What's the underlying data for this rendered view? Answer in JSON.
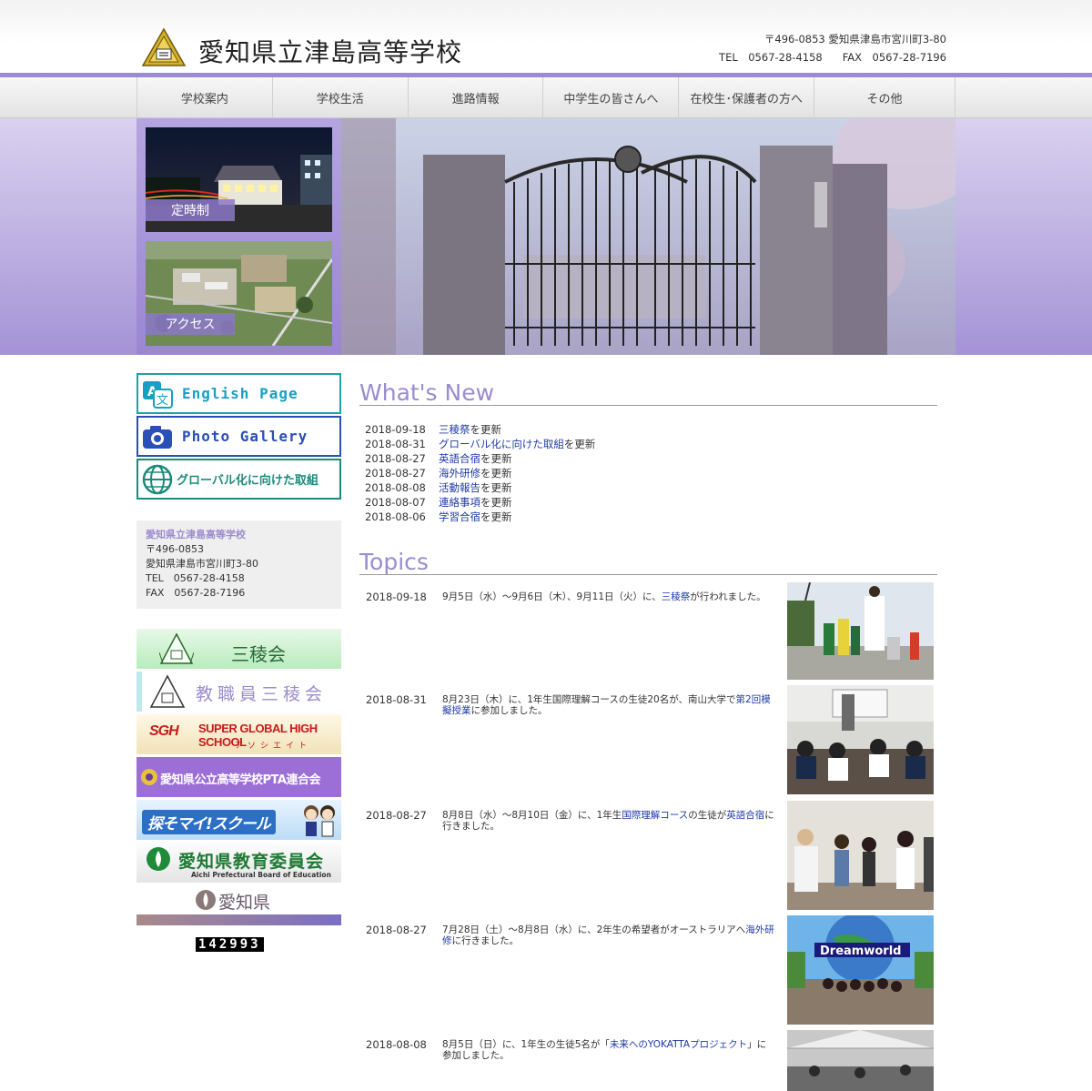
{
  "header": {
    "title": "愛知県立津島高等学校",
    "address": "〒496-0853 愛知県津島市宮川町3-80",
    "tel": "TEL　0567-28-4158",
    "fax": "FAX　0567-28-7196"
  },
  "nav": [
    "学校案内",
    "学校生活",
    "進路情報",
    "中学生の皆さんへ",
    "在校生･保護者の方へ",
    "その他"
  ],
  "hero": {
    "night_caption": "定時制",
    "access_caption": "アクセス"
  },
  "sidebar": {
    "links": [
      {
        "label": "English Page",
        "color": "#1a9fc4",
        "icon": "translate-icon"
      },
      {
        "label": "Photo Gallery",
        "color": "#2a4fb6",
        "icon": "camera-icon"
      },
      {
        "label": "グローバル化に向けた取組",
        "color": "#1c8a7a",
        "icon": "globe-icon"
      }
    ],
    "info": {
      "name": "愛知県立津島高等学校",
      "zip": "〒496-0853",
      "address": "愛知県津島市宮川町3-80",
      "tel": "TEL　0567-28-4158",
      "fax": "FAX　0567-28-7196"
    },
    "banners": {
      "sanryokai": "三稜会",
      "staff": "教職員三稜会",
      "sgh": "SUPER GLOBAL HIGH SCHOOL",
      "sgh_sub": "アソシエイト",
      "sgh_logo": "SGH",
      "pta": "愛知県公立高等学校PTA連合会",
      "myschool": "探そマイ!スクール",
      "board": "愛知県教育委員会",
      "board_en": "Aichi Prefectural Board of Education",
      "pref": "愛知県"
    },
    "counter": "142993"
  },
  "whats_new": {
    "title": "What's New",
    "items": [
      {
        "date": "2018-09-18",
        "link": "三稜祭",
        "suffix": "を更新"
      },
      {
        "date": "2018-08-31",
        "link": "グローバル化に向けた取組",
        "suffix": "を更新"
      },
      {
        "date": "2018-08-27",
        "link": "英語合宿",
        "suffix": "を更新"
      },
      {
        "date": "2018-08-27",
        "link": "海外研修",
        "suffix": "を更新"
      },
      {
        "date": "2018-08-08",
        "link": "活動報告",
        "suffix": "を更新"
      },
      {
        "date": "2018-08-07",
        "link": "連絡事項",
        "suffix": "を更新"
      },
      {
        "date": "2018-08-06",
        "link": "学習合宿",
        "suffix": "を更新"
      }
    ]
  },
  "topics": {
    "title": "Topics",
    "items": [
      {
        "date": "2018-09-18",
        "pre": "9月5日（水）～9月6日（木）、9月11日（火）に、",
        "link": "三稜祭",
        "post": "が行われました。"
      },
      {
        "date": "2018-08-31",
        "pre": "8月23日（木）に、1年生国際理解コースの生徒20名が、南山大学で",
        "link": "第2回模擬授業",
        "post": "に参加しました。"
      },
      {
        "date": "2018-08-27",
        "pre": "8月8日（水）～8月10日（金）に、1年生",
        "link": "国際理解コース",
        "mid": "の生徒が",
        "link2": "英語合宿",
        "post": "に行きました。"
      },
      {
        "date": "2018-08-27",
        "pre": "7月28日（土）～8月8日（水）に、2年生の希望者がオーストラリアへ",
        "link": "海外研修",
        "post": "に行きました。"
      },
      {
        "date": "2018-08-08",
        "pre": "8月5日（日）に、1年生の生徒5名が「",
        "link": "未来へのYOKATTAプロジェクト",
        "post": "」に参加しました。"
      }
    ],
    "photo_sign": "Dreamworld"
  }
}
